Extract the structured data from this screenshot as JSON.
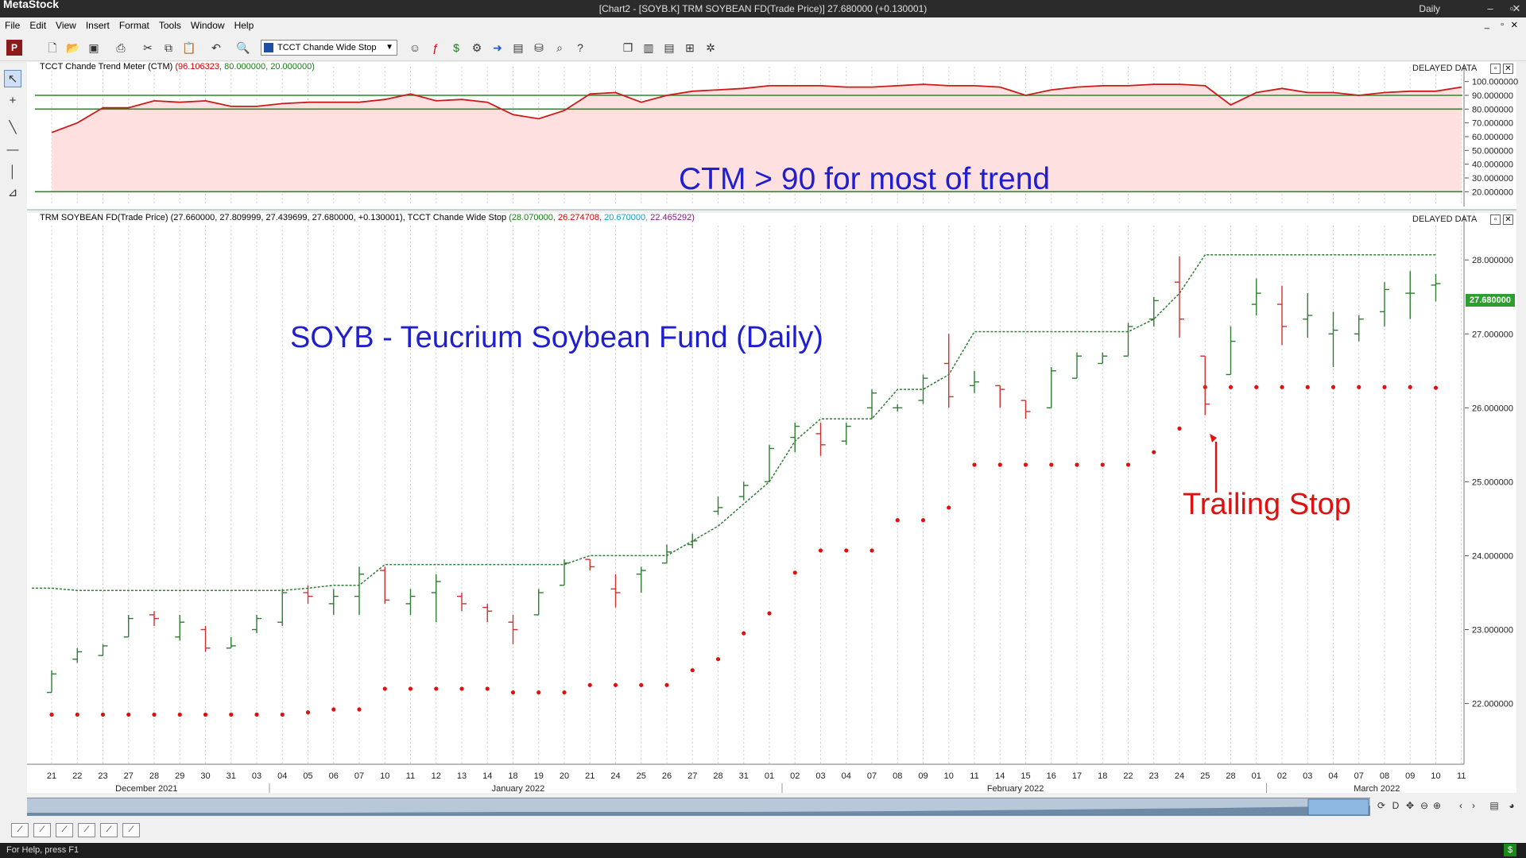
{
  "app": {
    "name": "MetaStock",
    "window_title": "[Chart2 - [SOYB.K] TRM SOYBEAN FD(Trade Price)]   27.680000 (+0.130001)",
    "period": "Daily",
    "status_text": "For Help, press F1"
  },
  "menu": [
    "File",
    "Edit",
    "View",
    "Insert",
    "Format",
    "Tools",
    "Window",
    "Help"
  ],
  "toolbar": {
    "indicator_select_value": "TCCT Chande Wide Stop"
  },
  "ctm_panel": {
    "title": "TCCT Chande Trend Meter (CTM)",
    "values": [
      "(96.106323,",
      "80.000000,",
      "20.000000)"
    ],
    "delayed_label": "DELAYED DATA",
    "annotation": "CTM > 90 for most of trend",
    "y_labels": [
      "100.000000",
      "90.000000",
      "80.000000",
      "70.000000",
      "60.000000",
      "50.000000",
      "40.000000",
      "30.000000",
      "20.000000"
    ],
    "y_values": [
      100,
      90,
      80,
      70,
      60,
      50,
      40,
      30,
      20
    ]
  },
  "price_panel": {
    "title_prefix": "TRM SOYBEAN FD(Trade Price)",
    "ohlc": "(27.660000, 27.809999, 27.439699, 27.680000, +0.130001),",
    "stop_title": "TCCT Chande Wide Stop",
    "stop_values": [
      "(28.070000,",
      "26.274708,",
      "20.670000,",
      "22.465292)"
    ],
    "delayed_label": "DELAYED DATA",
    "annotation_title": "SOYB - Teucrium Soybean Fund (Daily)",
    "annotation_stop": "Trailing Stop",
    "last_price_label": "27.680000",
    "y_labels": [
      "28.000000",
      "27.000000",
      "26.000000",
      "25.000000",
      "24.000000",
      "23.000000",
      "22.000000"
    ],
    "y_values": [
      28,
      27,
      26,
      25,
      24,
      23,
      22
    ]
  },
  "x_axis": {
    "day_labels": [
      "21",
      "22",
      "23",
      "27",
      "28",
      "29",
      "30",
      "31",
      "03",
      "04",
      "05",
      "06",
      "07",
      "10",
      "11",
      "12",
      "13",
      "14",
      "18",
      "19",
      "20",
      "21",
      "24",
      "25",
      "26",
      "27",
      "28",
      "31",
      "01",
      "02",
      "03",
      "04",
      "07",
      "08",
      "09",
      "10",
      "11",
      "14",
      "15",
      "16",
      "17",
      "18",
      "22",
      "23",
      "24",
      "25",
      "28",
      "01",
      "02",
      "03",
      "04",
      "07",
      "08",
      "09",
      "10",
      "11"
    ],
    "month_labels": [
      {
        "label": "December 2021",
        "index": 3.7
      },
      {
        "label": "January 2022",
        "index": 18.2
      },
      {
        "label": "February 2022",
        "index": 37.6
      },
      {
        "label": "March 2022",
        "index": 51.7
      }
    ]
  },
  "colors": {
    "up_bar": "#2e7d32",
    "down_bar": "#d32f2f",
    "stop_line": "#2e7d32",
    "stop_dots": "#e01010",
    "ctm_line": "#cc1a1a",
    "ctm_fill": "#ffe0e0",
    "ctm_level_lines": "#2a8a2a",
    "annotation_blue": "#1f1fd0",
    "annotation_red": "#e01010",
    "last_price_box": "#2e9e2e"
  },
  "chart_data": [
    {
      "type": "line",
      "title": "TCCT Chande Trend Meter (CTM)",
      "ylim": [
        15,
        105
      ],
      "levels": [
        90,
        80,
        20
      ],
      "values": [
        63,
        70,
        81,
        81,
        86,
        85,
        86,
        82,
        82,
        84,
        85,
        85,
        85,
        87,
        91,
        86,
        87,
        85,
        76,
        73,
        79,
        91,
        92,
        85,
        90,
        93,
        94,
        95,
        97,
        97,
        97,
        96,
        96,
        97,
        98,
        97,
        97,
        96,
        90,
        94,
        96,
        97,
        97,
        98,
        98,
        97,
        83,
        92,
        95,
        92,
        92,
        90,
        92,
        93,
        93,
        96
      ]
    },
    {
      "type": "ohlc",
      "title": "TRM SOYBEAN FD(Trade Price)",
      "ylim": [
        21.2,
        28.4
      ],
      "bars": [
        {
          "o": 22.15,
          "h": 22.45,
          "l": 22.15,
          "c": 22.4
        },
        {
          "o": 22.6,
          "h": 22.75,
          "l": 22.55,
          "c": 22.7
        },
        {
          "o": 22.65,
          "h": 22.8,
          "l": 22.65,
          "c": 22.78
        },
        {
          "o": 22.9,
          "h": 23.2,
          "l": 22.9,
          "c": 23.15
        },
        {
          "o": 23.2,
          "h": 23.25,
          "l": 23.05,
          "c": 23.15
        },
        {
          "o": 22.9,
          "h": 23.2,
          "l": 22.85,
          "c": 23.1
        },
        {
          "o": 23.0,
          "h": 23.05,
          "l": 22.7,
          "c": 22.75
        },
        {
          "o": 22.75,
          "h": 22.9,
          "l": 22.75,
          "c": 22.78
        },
        {
          "o": 23.0,
          "h": 23.2,
          "l": 22.95,
          "c": 23.15
        },
        {
          "o": 23.1,
          "h": 23.55,
          "l": 23.05,
          "c": 23.5
        },
        {
          "o": 23.5,
          "h": 23.6,
          "l": 23.35,
          "c": 23.45
        },
        {
          "o": 23.35,
          "h": 23.55,
          "l": 23.2,
          "c": 23.45
        },
        {
          "o": 23.45,
          "h": 23.85,
          "l": 23.2,
          "c": 23.75
        },
        {
          "o": 23.8,
          "h": 23.85,
          "l": 23.35,
          "c": 23.4
        },
        {
          "o": 23.35,
          "h": 23.55,
          "l": 23.2,
          "c": 23.45
        },
        {
          "o": 23.5,
          "h": 23.75,
          "l": 23.1,
          "c": 23.65
        },
        {
          "o": 23.45,
          "h": 23.5,
          "l": 23.25,
          "c": 23.35
        },
        {
          "o": 23.3,
          "h": 23.35,
          "l": 23.1,
          "c": 23.25
        },
        {
          "o": 23.1,
          "h": 23.2,
          "l": 22.8,
          "c": 23.0
        },
        {
          "o": 23.2,
          "h": 23.55,
          "l": 23.2,
          "c": 23.5
        },
        {
          "o": 23.6,
          "h": 23.95,
          "l": 23.6,
          "c": 23.9
        },
        {
          "o": 23.95,
          "h": 23.95,
          "l": 23.8,
          "c": 23.85
        },
        {
          "o": 23.55,
          "h": 23.75,
          "l": 23.3,
          "c": 23.5
        },
        {
          "o": 23.75,
          "h": 23.85,
          "l": 23.5,
          "c": 23.8
        },
        {
          "o": 23.9,
          "h": 24.15,
          "l": 23.9,
          "c": 24.05
        },
        {
          "o": 24.15,
          "h": 24.3,
          "l": 24.1,
          "c": 24.2
        },
        {
          "o": 24.6,
          "h": 24.8,
          "l": 24.55,
          "c": 24.65
        },
        {
          "o": 24.8,
          "h": 25.0,
          "l": 24.75,
          "c": 24.95
        },
        {
          "o": 25.0,
          "h": 25.5,
          "l": 25.0,
          "c": 25.45
        },
        {
          "o": 25.6,
          "h": 25.8,
          "l": 25.4,
          "c": 25.75
        },
        {
          "o": 25.65,
          "h": 25.8,
          "l": 25.35,
          "c": 25.5
        },
        {
          "o": 25.55,
          "h": 25.8,
          "l": 25.5,
          "c": 25.75
        },
        {
          "o": 26.0,
          "h": 26.25,
          "l": 25.85,
          "c": 26.2
        },
        {
          "o": 26.0,
          "h": 26.05,
          "l": 25.95,
          "c": 26.0
        },
        {
          "o": 26.1,
          "h": 26.45,
          "l": 26.05,
          "c": 26.4
        },
        {
          "o": 26.6,
          "h": 27.0,
          "l": 26.0,
          "c": 26.15
        },
        {
          "o": 26.3,
          "h": 26.5,
          "l": 26.2,
          "c": 26.35
        },
        {
          "o": 26.3,
          "h": 26.3,
          "l": 26.0,
          "c": 26.25
        },
        {
          "o": 26.1,
          "h": 26.1,
          "l": 25.85,
          "c": 25.95
        },
        {
          "o": 26.0,
          "h": 26.55,
          "l": 26.0,
          "c": 26.5
        },
        {
          "o": 26.4,
          "h": 26.75,
          "l": 26.4,
          "c": 26.7
        },
        {
          "o": 26.6,
          "h": 26.75,
          "l": 26.6,
          "c": 26.7
        },
        {
          "o": 26.7,
          "h": 27.15,
          "l": 26.7,
          "c": 27.1
        },
        {
          "o": 27.2,
          "h": 27.5,
          "l": 27.1,
          "c": 27.45
        },
        {
          "o": 27.7,
          "h": 28.05,
          "l": 26.95,
          "c": 27.2
        },
        {
          "o": 26.7,
          "h": 26.7,
          "l": 25.9,
          "c": 26.05
        },
        {
          "o": 26.45,
          "h": 27.1,
          "l": 26.45,
          "c": 26.9
        },
        {
          "o": 27.4,
          "h": 27.75,
          "l": 27.25,
          "c": 27.55
        },
        {
          "o": 27.4,
          "h": 27.65,
          "l": 26.85,
          "c": 27.1
        },
        {
          "o": 27.2,
          "h": 27.55,
          "l": 26.95,
          "c": 27.25
        },
        {
          "o": 27.0,
          "h": 27.3,
          "l": 26.55,
          "c": 27.05
        },
        {
          "o": 27.0,
          "h": 27.25,
          "l": 26.9,
          "c": 27.2
        },
        {
          "o": 27.3,
          "h": 27.7,
          "l": 27.1,
          "c": 27.6
        },
        {
          "o": 27.55,
          "h": 27.85,
          "l": 27.2,
          "c": 27.55
        },
        {
          "o": 27.66,
          "h": 27.81,
          "l": 27.44,
          "c": 27.68
        }
      ],
      "stop_line": [
        23.56,
        23.53,
        23.53,
        23.53,
        23.53,
        23.53,
        23.53,
        23.53,
        23.53,
        23.53,
        23.56,
        23.6,
        23.6,
        23.88,
        23.88,
        23.88,
        23.88,
        23.88,
        23.88,
        23.88,
        23.88,
        24.0,
        24.0,
        24.0,
        24.0,
        24.2,
        24.4,
        24.7,
        25.0,
        25.55,
        25.85,
        25.85,
        25.85,
        26.25,
        26.25,
        26.45,
        27.03,
        27.03,
        27.03,
        27.03,
        27.03,
        27.03,
        27.03,
        27.2,
        27.55,
        28.07,
        28.07,
        28.07,
        28.07,
        28.07,
        28.07,
        28.07,
        28.07,
        28.07,
        28.07
      ],
      "stop_dots": [
        21.85,
        21.85,
        21.85,
        21.85,
        21.85,
        21.85,
        21.85,
        21.85,
        21.85,
        21.85,
        21.88,
        21.92,
        21.92,
        22.2,
        22.2,
        22.2,
        22.2,
        22.2,
        22.15,
        22.15,
        22.15,
        22.25,
        22.25,
        22.25,
        22.25,
        22.45,
        22.6,
        22.95,
        23.22,
        23.77,
        24.07,
        24.07,
        24.07,
        24.48,
        24.48,
        24.65,
        25.23,
        25.23,
        25.23,
        25.23,
        25.23,
        25.23,
        25.23,
        25.4,
        25.72,
        26.28,
        26.28,
        26.28,
        26.28,
        26.28,
        26.28,
        26.28,
        26.28,
        26.28,
        26.27
      ]
    }
  ]
}
